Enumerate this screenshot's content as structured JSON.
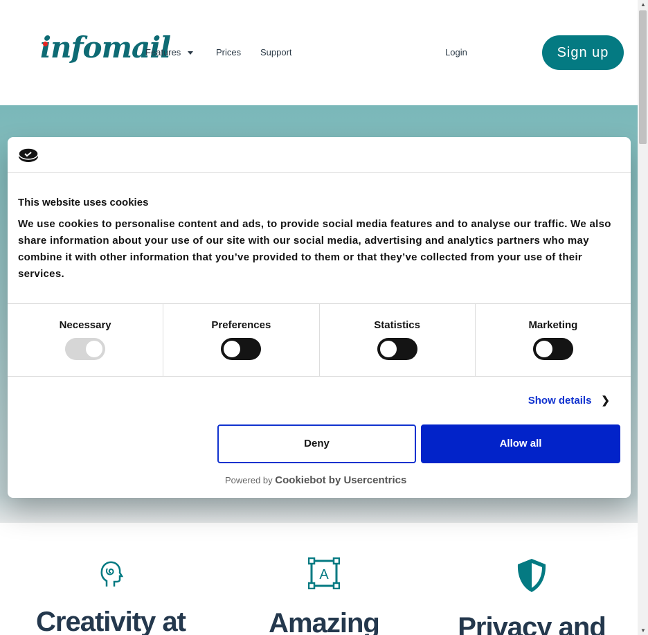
{
  "header": {
    "logo": "infomail",
    "nav": [
      {
        "label": "Features"
      },
      {
        "label": "Prices"
      },
      {
        "label": "Support"
      }
    ],
    "login": "Login",
    "signup": "Sign up"
  },
  "cookie": {
    "title": "This website uses cookies",
    "text": "We use cookies to personalise content and ads, to provide social media features and to analyse our traffic. We also share information about your use of our site with our social media, advertising and analytics partners who may combine it with other information that you’ve provided to them or that they’ve collected from your use of their services.",
    "categories": [
      {
        "label": "Necessary",
        "on": true,
        "disabled": true
      },
      {
        "label": "Preferences",
        "on": false
      },
      {
        "label": "Statistics",
        "on": false
      },
      {
        "label": "Marketing",
        "on": false
      }
    ],
    "show_details": "Show details",
    "deny": "Deny",
    "allow_all": "Allow all",
    "powered_by": "Powered by",
    "brand": "Cookiebot by Usercentrics"
  },
  "features": [
    {
      "title": "Creativity at",
      "icon": "head-spiral-icon"
    },
    {
      "title": "Amazing",
      "icon": "text-frame-icon"
    },
    {
      "title": "Privacy and",
      "icon": "shield-icon"
    }
  ],
  "colors": {
    "brand": "#047a82",
    "primary_button": "#0223c9"
  }
}
